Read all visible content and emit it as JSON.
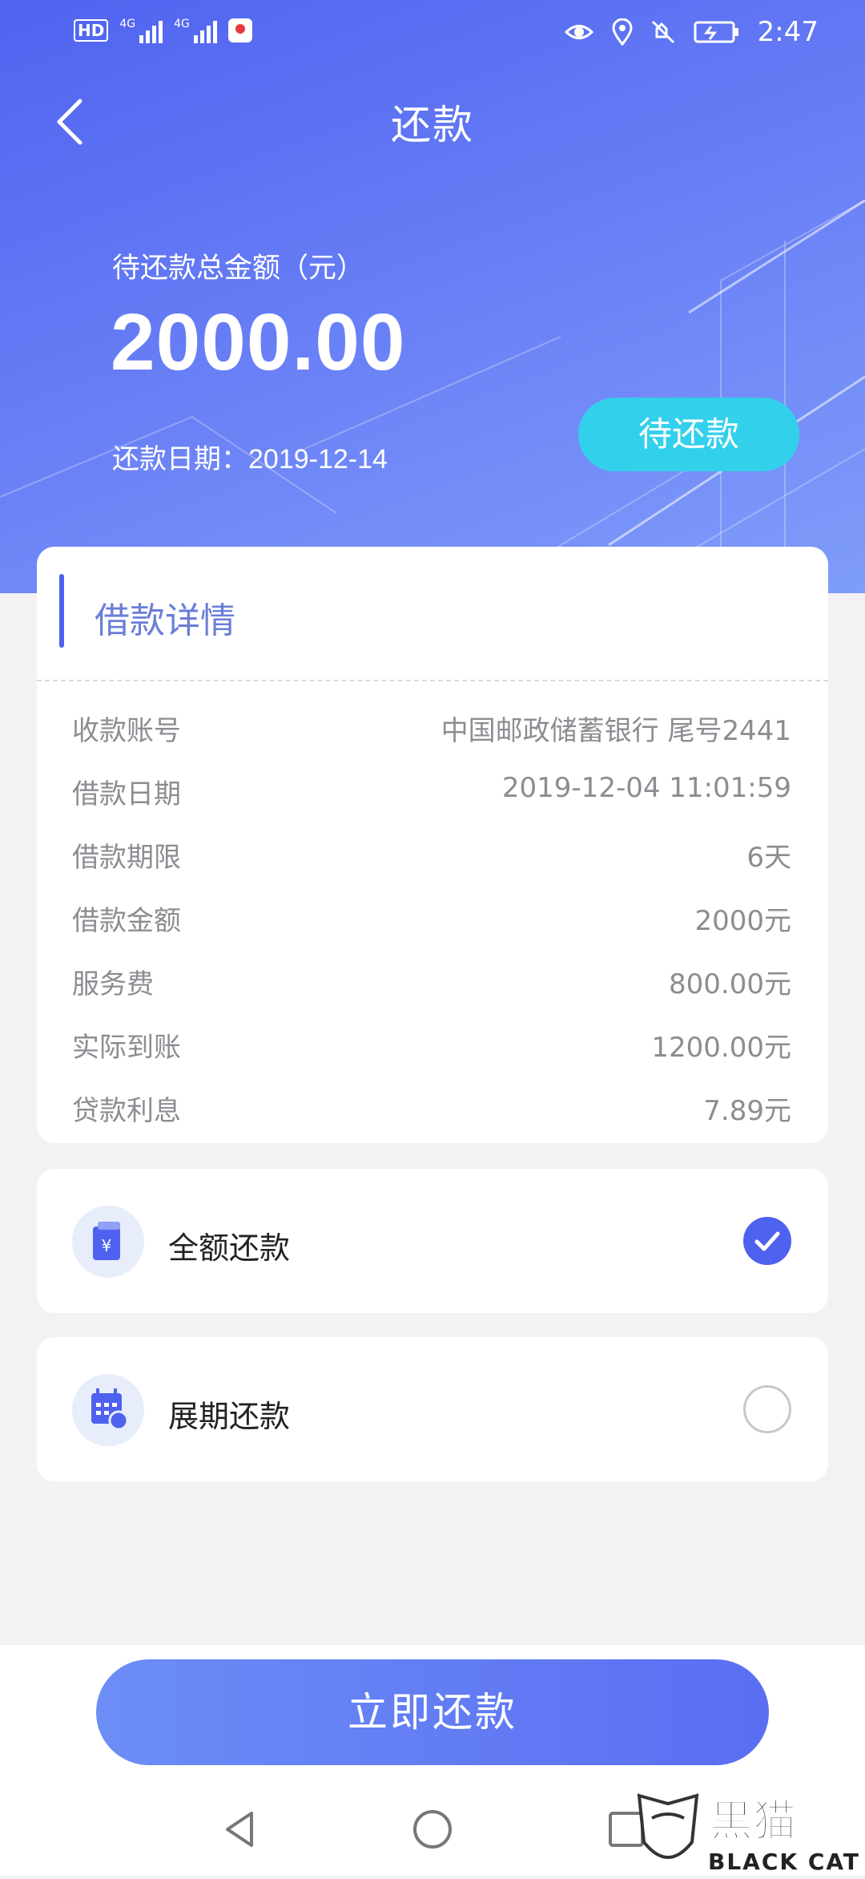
{
  "status_bar": {
    "hd": "HD",
    "net1": "4G",
    "net2": "4G",
    "time": "2:47"
  },
  "header": {
    "title": "还款",
    "amount_label": "待还款总金额（元）",
    "amount": "2000.00",
    "due_date_label": "还款日期：",
    "due_date": "2019-12-14",
    "status": "待还款"
  },
  "detail": {
    "title": "借款详情",
    "rows": [
      {
        "label": "收款账号",
        "value": "中国邮政储蓄银行 尾号2441"
      },
      {
        "label": "借款日期",
        "value": "2019-12-04 11:01:59"
      },
      {
        "label": "借款期限",
        "value": "6天"
      },
      {
        "label": "借款金额",
        "value": "2000元"
      },
      {
        "label": "服务费",
        "value": "800.00元"
      },
      {
        "label": "实际到账",
        "value": "1200.00元"
      },
      {
        "label": "贷款利息",
        "value": "7.89元"
      }
    ]
  },
  "options": [
    {
      "label": "全额还款",
      "icon": "wallet-yuan-icon",
      "selected": true
    },
    {
      "label": "展期还款",
      "icon": "calendar-icon",
      "selected": false
    }
  ],
  "pay_button": "立即还款",
  "watermark": {
    "cn": "黑猫",
    "en": "BLACK CAT"
  },
  "colors": {
    "accent": "#4e62ef",
    "status_pill": "#33d0ec",
    "header_start": "#4f63f0",
    "header_end": "#7f9dfa"
  }
}
